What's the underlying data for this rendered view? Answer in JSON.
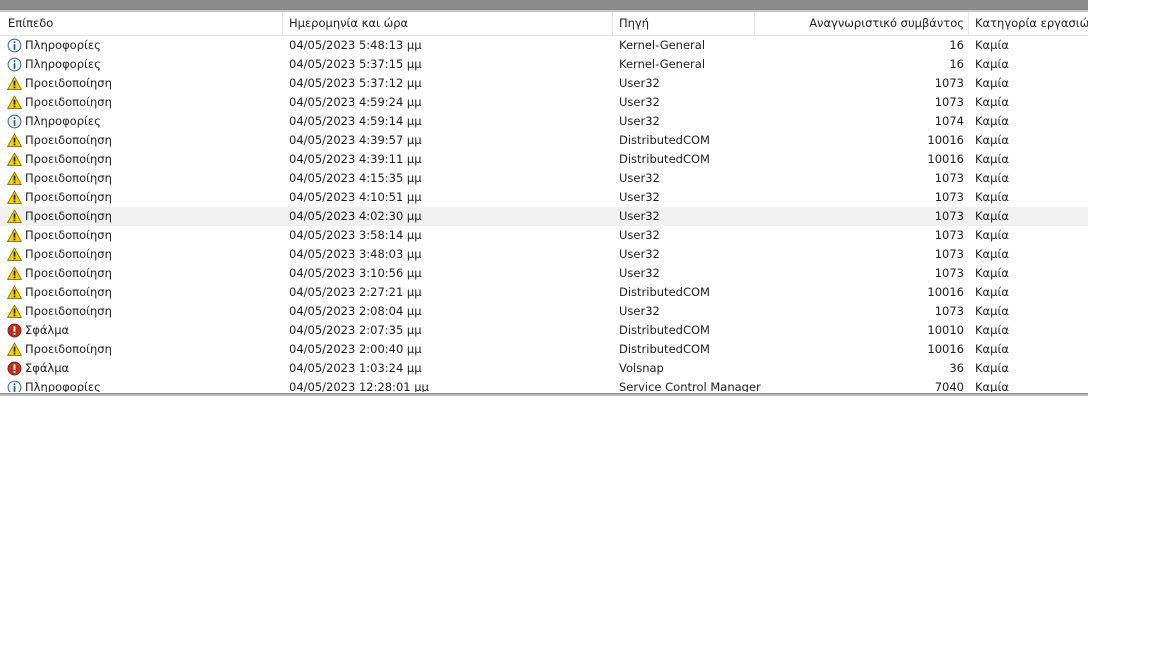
{
  "columns": {
    "level": "Επίπεδο",
    "date": "Ημερομηνία και ώρα",
    "source": "Πηγή",
    "event_id": "Αναγνωριστικό συμβάντος",
    "category": "Κατηγορία εργασιών"
  },
  "icon_colors": {
    "info": "#3c6fb4",
    "warning": "#f5d000",
    "error": "#c42b1c"
  },
  "events": [
    {
      "type": "info",
      "level": "Πληροφορίες",
      "date": "04/05/2023 5:48:13 μμ",
      "source": "Kernel-General",
      "event_id": "16",
      "category": "Καμία"
    },
    {
      "type": "info",
      "level": "Πληροφορίες",
      "date": "04/05/2023 5:37:15 μμ",
      "source": "Kernel-General",
      "event_id": "16",
      "category": "Καμία"
    },
    {
      "type": "warning",
      "level": "Προειδοποίηση",
      "date": "04/05/2023 5:37:12 μμ",
      "source": "User32",
      "event_id": "1073",
      "category": "Καμία"
    },
    {
      "type": "warning",
      "level": "Προειδοποίηση",
      "date": "04/05/2023 4:59:24 μμ",
      "source": "User32",
      "event_id": "1073",
      "category": "Καμία"
    },
    {
      "type": "info",
      "level": "Πληροφορίες",
      "date": "04/05/2023 4:59:14 μμ",
      "source": "User32",
      "event_id": "1074",
      "category": "Καμία"
    },
    {
      "type": "warning",
      "level": "Προειδοποίηση",
      "date": "04/05/2023 4:39:57 μμ",
      "source": "DistributedCOM",
      "event_id": "10016",
      "category": "Καμία"
    },
    {
      "type": "warning",
      "level": "Προειδοποίηση",
      "date": "04/05/2023 4:39:11 μμ",
      "source": "DistributedCOM",
      "event_id": "10016",
      "category": "Καμία"
    },
    {
      "type": "warning",
      "level": "Προειδοποίηση",
      "date": "04/05/2023 4:15:35 μμ",
      "source": "User32",
      "event_id": "1073",
      "category": "Καμία"
    },
    {
      "type": "warning",
      "level": "Προειδοποίηση",
      "date": "04/05/2023 4:10:51 μμ",
      "source": "User32",
      "event_id": "1073",
      "category": "Καμία"
    },
    {
      "type": "warning",
      "level": "Προειδοποίηση",
      "date": "04/05/2023 4:02:30 μμ",
      "source": "User32",
      "event_id": "1073",
      "category": "Καμία",
      "selected": true
    },
    {
      "type": "warning",
      "level": "Προειδοποίηση",
      "date": "04/05/2023 3:58:14 μμ",
      "source": "User32",
      "event_id": "1073",
      "category": "Καμία"
    },
    {
      "type": "warning",
      "level": "Προειδοποίηση",
      "date": "04/05/2023 3:48:03 μμ",
      "source": "User32",
      "event_id": "1073",
      "category": "Καμία"
    },
    {
      "type": "warning",
      "level": "Προειδοποίηση",
      "date": "04/05/2023 3:10:56 μμ",
      "source": "User32",
      "event_id": "1073",
      "category": "Καμία"
    },
    {
      "type": "warning",
      "level": "Προειδοποίηση",
      "date": "04/05/2023 2:27:21 μμ",
      "source": "DistributedCOM",
      "event_id": "10016",
      "category": "Καμία"
    },
    {
      "type": "warning",
      "level": "Προειδοποίηση",
      "date": "04/05/2023 2:08:04 μμ",
      "source": "User32",
      "event_id": "1073",
      "category": "Καμία"
    },
    {
      "type": "error",
      "level": "Σφάλμα",
      "date": "04/05/2023 2:07:35 μμ",
      "source": "DistributedCOM",
      "event_id": "10010",
      "category": "Καμία"
    },
    {
      "type": "warning",
      "level": "Προειδοποίηση",
      "date": "04/05/2023 2:00:40 μμ",
      "source": "DistributedCOM",
      "event_id": "10016",
      "category": "Καμία"
    },
    {
      "type": "error",
      "level": "Σφάλμα",
      "date": "04/05/2023 1:03:24 μμ",
      "source": "Volsnap",
      "event_id": "36",
      "category": "Καμία"
    },
    {
      "type": "info",
      "level": "Πληροφορίες",
      "date": "04/05/2023 12:28:01 μμ",
      "source": "Service Control Manager",
      "event_id": "7040",
      "category": "Καμία"
    }
  ]
}
